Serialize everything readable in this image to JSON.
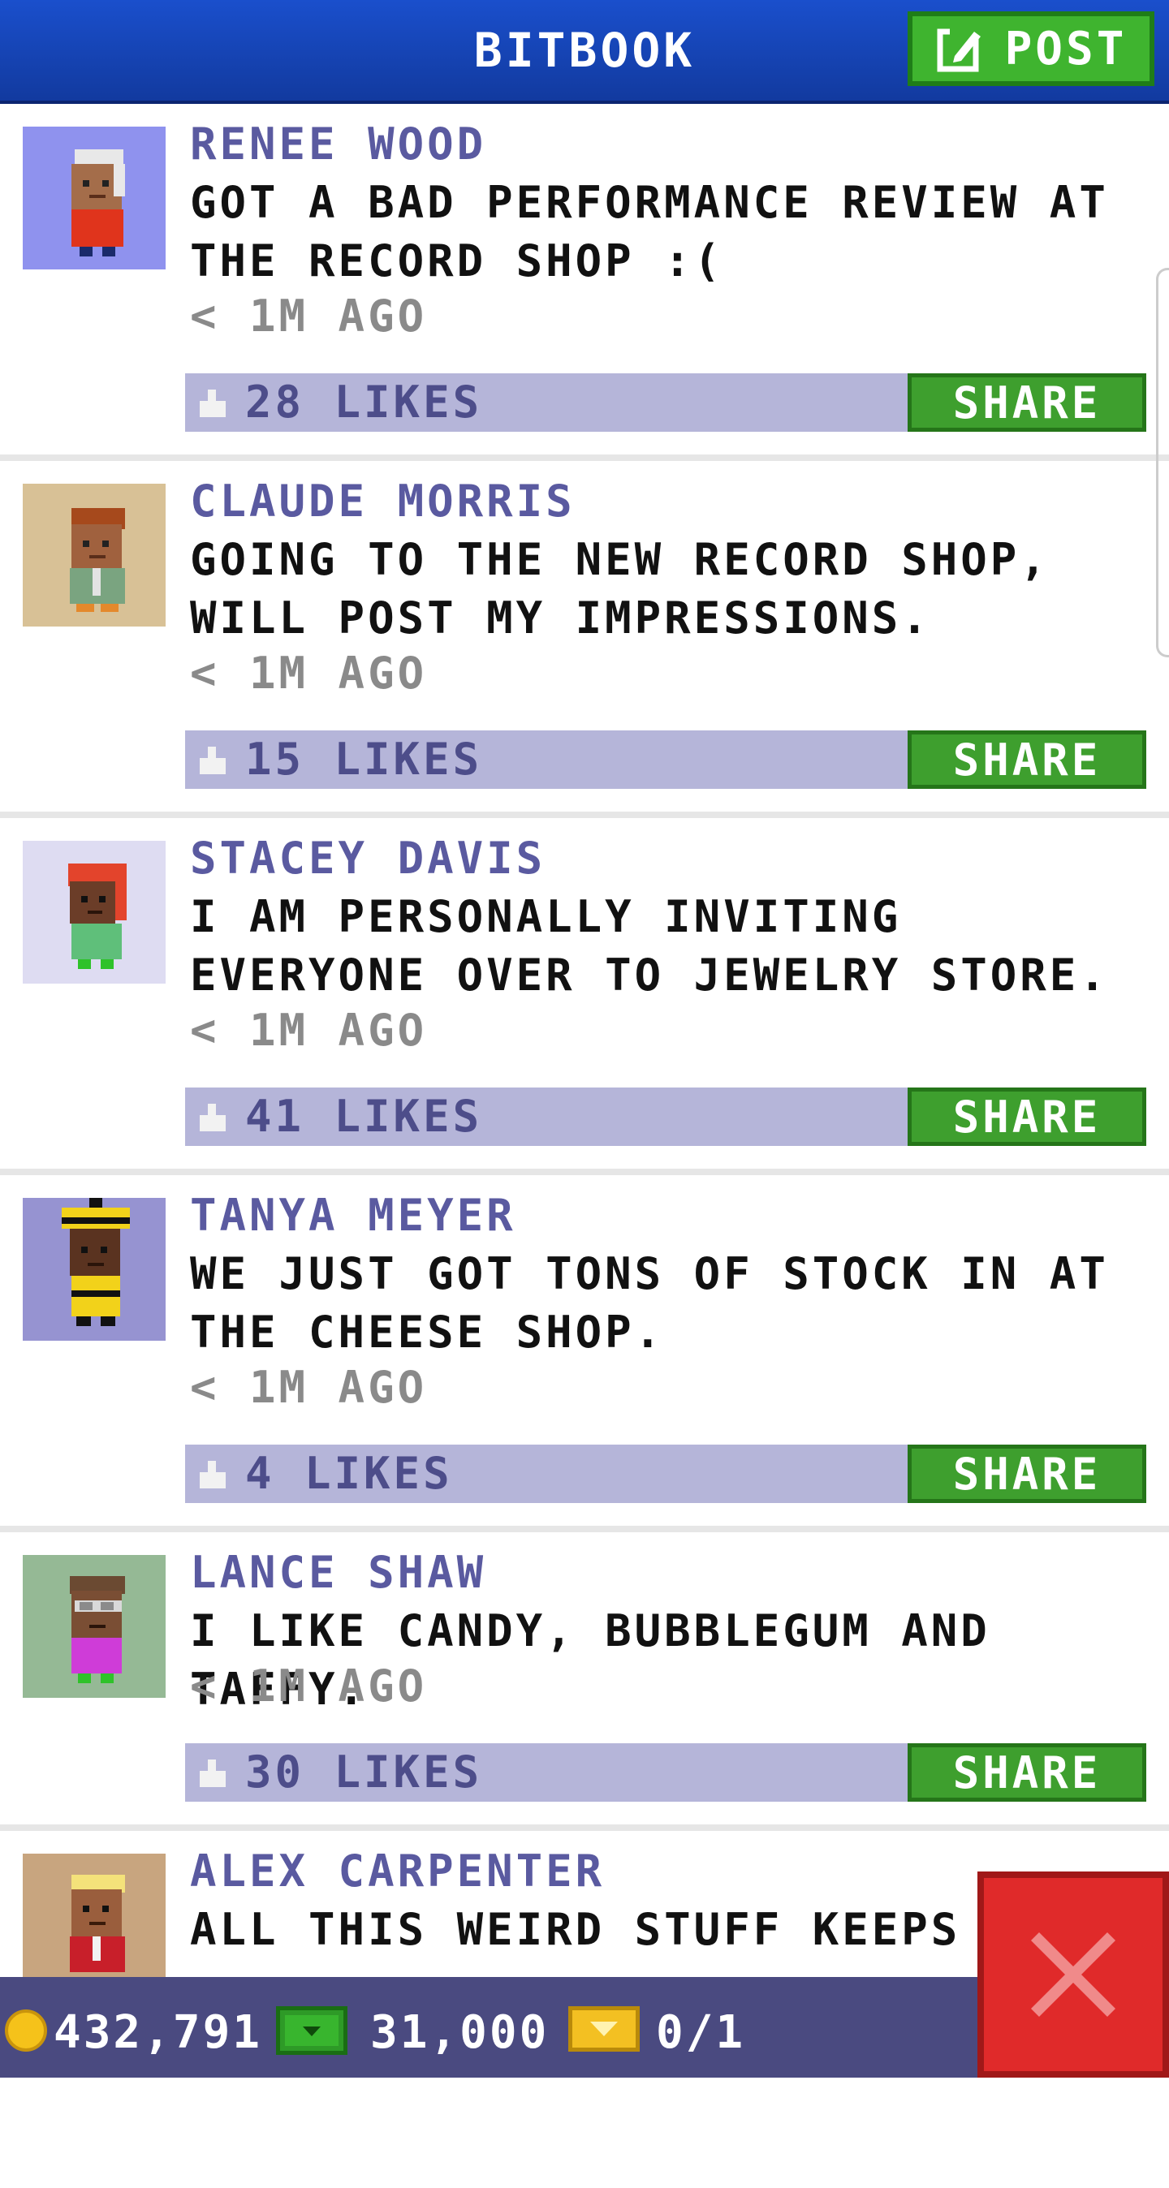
{
  "header": {
    "title": "BITBOOK",
    "post_label": "POST"
  },
  "posts": [
    {
      "author": "RENEE WOOD",
      "message": "GOT A BAD PERFORMANCE REVIEW AT THE RECORD SHOP :(",
      "time": "< 1M AGO",
      "likes": "28 LIKES",
      "share_label": "SHARE",
      "avatar_bg": "#8f92ee"
    },
    {
      "author": "CLAUDE MORRIS",
      "message": "GOING TO THE NEW RECORD SHOP, WILL POST MY IMPRESSIONS.",
      "time": "< 1M AGO",
      "likes": "15 LIKES",
      "share_label": "SHARE",
      "avatar_bg": "#d8c196"
    },
    {
      "author": "STACEY DAVIS",
      "message": "I AM PERSONALLY INVITING EVERYONE OVER TO JEWELRY STORE.",
      "time": "< 1M AGO",
      "likes": "41 LIKES",
      "share_label": "SHARE",
      "avatar_bg": "#dedcf2"
    },
    {
      "author": "TANYA MEYER",
      "message": "WE JUST GOT TONS OF STOCK IN AT THE CHEESE SHOP.",
      "time": "< 1M AGO",
      "likes": "4 LIKES",
      "share_label": "SHARE",
      "avatar_bg": "#9693d1"
    },
    {
      "author": "LANCE SHAW",
      "message": "I LIKE CANDY, BUBBLEGUM AND TAFFY.",
      "time": "< 1M AGO",
      "likes": "30 LIKES",
      "share_label": "SHARE",
      "avatar_bg": "#95b995"
    },
    {
      "author": "ALEX CARPENTER",
      "message": "ALL THIS WEIRD STUFF KEEPS SH",
      "avatar_bg": "#c8a57f"
    }
  ],
  "bottom_bar": {
    "coins": "432,791",
    "bux": "31,000",
    "tickets": "0/1"
  },
  "icons": {
    "post": "edit-icon",
    "like": "thumbs-up-icon",
    "coin": "coin-icon",
    "bux": "bux-icon",
    "ticket": "ticket-icon",
    "close": "close-icon"
  },
  "colors": {
    "header": "#1a4fcc",
    "share": "#3e9f2e",
    "likes_bar": "#b5b5d9",
    "author": "#5a5aa0",
    "close": "#e02a2a"
  }
}
